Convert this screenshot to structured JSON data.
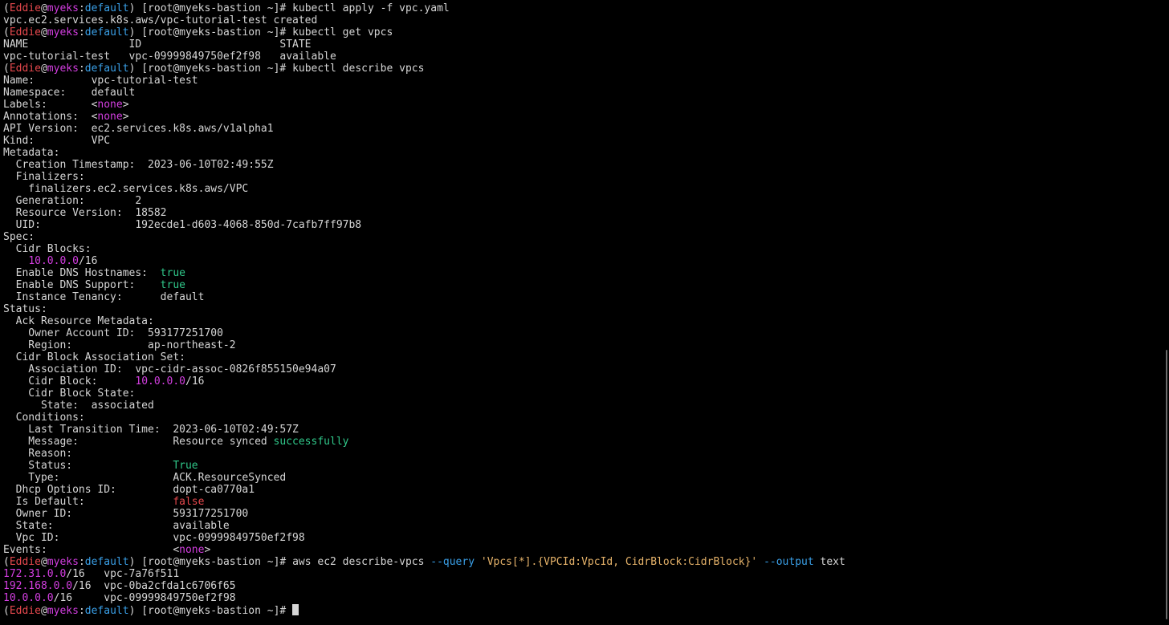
{
  "prompt": {
    "open": "(",
    "user": "Eddie",
    "at": "@",
    "host": "myeks",
    "colon": ":",
    "ns": "default",
    "rest": ") [root@myeks-bastion ~]# "
  },
  "commands": {
    "cmd1": "kubectl apply -f vpc.yaml",
    "cmd2": "kubectl get vpcs",
    "cmd3": "kubectl describe vpcs",
    "cmd4_a": "aws ec2 describe-vpcs ",
    "cmd4_query": "--query",
    "cmd4_b": " ",
    "cmd4_str": "'Vpcs[*].{VPCId:VpcId, CidrBlock:CidrBlock}'",
    "cmd4_c": " ",
    "cmd4_output": "--output",
    "cmd4_d": " text"
  },
  "output": {
    "apply_result": "vpc.ec2.services.k8s.aws/vpc-tutorial-test created",
    "get_header": "NAME                ID                      STATE",
    "get_row": "vpc-tutorial-test   vpc-09999849750ef2f98   available",
    "name": "Name:         vpc-tutorial-test",
    "namespace": "Namespace:    default",
    "labels_key": "Labels:       ",
    "annotations_key": "Annotations:  ",
    "none_open": "<",
    "none_word": "none",
    "none_close": ">",
    "api_version": "API Version:  ec2.services.k8s.aws/v1alpha1",
    "kind": "Kind:         VPC",
    "metadata": "Metadata:",
    "creation_ts": "  Creation Timestamp:  2023-06-10T02:49:55Z",
    "finalizers": "  Finalizers:",
    "finalizer_val": "    finalizers.ec2.services.k8s.aws/VPC",
    "generation": "  Generation:        2",
    "resource_version": "  Resource Version:  18582",
    "uid": "  UID:               192ecde1-d603-4068-850d-7cafb7ff97b8",
    "spec": "Spec:",
    "cidr_blocks": "  Cidr Blocks:",
    "cidr_indent": "    ",
    "cidr_ip": "10.0.0.0",
    "cidr_mask": "/16",
    "dns_hostnames_key": "  Enable DNS Hostnames:  ",
    "dns_support_key": "  Enable DNS Support:    ",
    "true_word": "true",
    "tenancy": "  Instance Tenancy:      default",
    "status": "Status:",
    "ack_meta": "  Ack Resource Metadata:",
    "owner_account": "    Owner Account ID:  593177251700",
    "region": "    Region:            ap-northeast-2",
    "cidr_assoc_set": "  Cidr Block Association Set:",
    "assoc_id": "    Association ID:  vpc-cidr-assoc-0826f855150e94a07",
    "cidr_block_key": "    Cidr Block:      ",
    "cidr_block_state": "    Cidr Block State:",
    "state_assoc": "      State:  associated",
    "conditions": "  Conditions:",
    "last_transition": "    Last Transition Time:  2023-06-10T02:49:57Z",
    "message_key": "    Message:               Resource synced ",
    "message_success": "successfully",
    "reason": "    Reason:",
    "status_key": "    Status:                ",
    "status_val": "True",
    "type": "    Type:                  ACK.ResourceSynced",
    "dhcp": "  Dhcp Options ID:         dopt-ca0770a1",
    "is_default_key": "  Is Default:              ",
    "is_default_val": "false",
    "owner_id": "  Owner ID:                593177251700",
    "state": "  State:                   available",
    "vpc_id": "  Vpc ID:                  vpc-09999849750ef2f98",
    "events_key": "Events:                    ",
    "row1_ip": "172.31.0.0",
    "row1_rest": "/16   vpc-7a76f511",
    "row2_ip": "192.168.0.0",
    "row2_rest": "/16  vpc-0ba2cfda1c6706f65",
    "row3_ip": "10.0.0.0",
    "row3_rest": "/16     vpc-09999849750ef2f98"
  },
  "colors": {
    "background": "#000000",
    "text": "#d6d6d6",
    "user": "#e5484d",
    "host": "#d33ee0",
    "namespace": "#3aa0e8",
    "true_green": "#30c88a",
    "false_red": "#e5484d",
    "ip_magenta": "#d33ee0"
  }
}
